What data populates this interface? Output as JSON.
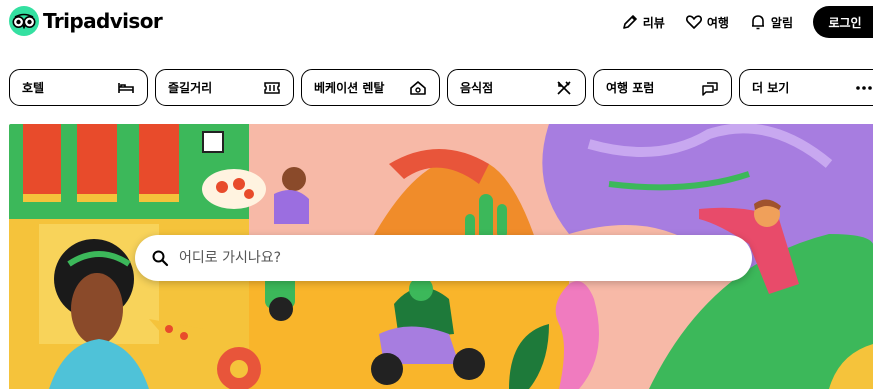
{
  "header": {
    "logo_text": "Tripadvisor",
    "nav": [
      {
        "label": "리뷰",
        "icon": "pencil-icon"
      },
      {
        "label": "여행",
        "icon": "heart-icon"
      },
      {
        "label": "알림",
        "icon": "bell-icon"
      }
    ],
    "login_label": "로그인"
  },
  "categories": [
    {
      "label": "호텔",
      "icon": "bed-icon"
    },
    {
      "label": "즐길거리",
      "icon": "ticket-icon"
    },
    {
      "label": "베케이션 렌탈",
      "icon": "house-icon"
    },
    {
      "label": "음식점",
      "icon": "utensils-icon"
    },
    {
      "label": "여행 포럼",
      "icon": "chat-bubbles-icon"
    },
    {
      "label": "더 보기",
      "icon": "more-dots-icon"
    }
  ],
  "search": {
    "placeholder": "어디로 가시나요?",
    "icon": "search-icon"
  },
  "colors": {
    "brand_green": "#34e0a1",
    "black": "#000000"
  }
}
